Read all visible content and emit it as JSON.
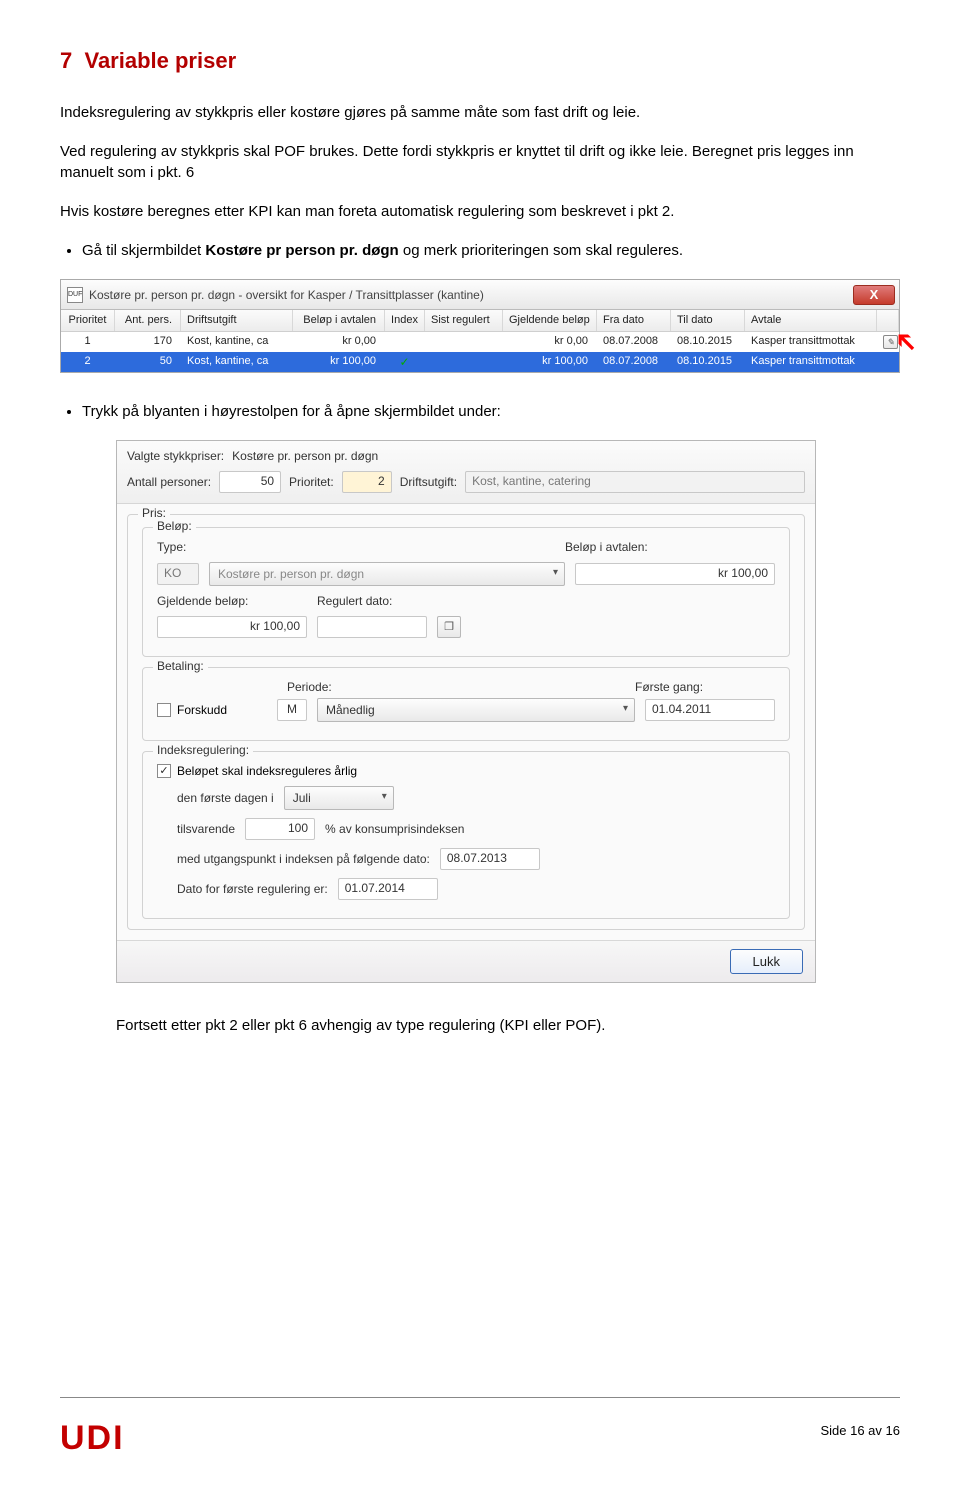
{
  "section": {
    "number": "7",
    "title": "Variable priser",
    "text1": "Indeksregulering av stykkpris eller kostøre gjøres på samme måte som fast drift og leie.",
    "text2": "Ved regulering av stykkpris skal POF brukes. Dette fordi stykkpris er knyttet til drift og ikke leie. Beregnet pris legges inn manuelt som i pkt. 6",
    "text3": "Hvis kostøre beregnes etter KPI kan man foreta automatisk regulering som beskrevet i pkt 2.",
    "bullet1_a": "Gå til skjermbildet ",
    "bullet1_b": "Kostøre pr person pr. døgn",
    "bullet1_c": " og merk prioriteringen som skal reguleres.",
    "bullet2": "Trykk på blyanten i høyrestolpen for å åpne skjermbildet under:",
    "text4": "Fortsett etter pkt 2 eller pkt 6 avhengig av type regulering (KPI eller POF)."
  },
  "grid": {
    "title": "Kostøre pr. person pr. døgn - oversikt for Kasper / Transittplasser (kantine)",
    "app_icon": "DUF",
    "columns": {
      "prioritet": "Prioritet",
      "ant": "Ant. pers.",
      "drift": "Driftsutgift",
      "belop": "Beløp i avtalen",
      "index": "Index",
      "sist": "Sist regulert",
      "gj": "Gjeldende beløp",
      "fra": "Fra dato",
      "til": "Til dato",
      "avtale": "Avtale"
    },
    "rows": [
      {
        "prio": "1",
        "ant": "170",
        "drift": "Kost, kantine, ca",
        "belop": "kr 0,00",
        "index": "",
        "sist": "",
        "gj": "kr 0,00",
        "fra": "08.07.2008",
        "til": "08.10.2015",
        "avt": "Kasper transittmottak"
      },
      {
        "prio": "2",
        "ant": "50",
        "drift": "Kost, kantine, ca",
        "belop": "kr 100,00",
        "index": "✓",
        "sist": "",
        "gj": "kr 100,00",
        "fra": "08.07.2008",
        "til": "08.10.2015",
        "avt": "Kasper transittmottak"
      }
    ]
  },
  "form": {
    "valgte_label": "Valgte stykkpriser:",
    "valgte_value": "Kostøre pr. person pr. døgn",
    "antall_label": "Antall personer:",
    "antall_value": "50",
    "prioritet_label": "Prioritet:",
    "prioritet_value": "2",
    "driftsutgift_label": "Driftsutgift:",
    "driftsutgift_value": "Kost, kantine, catering",
    "pris_legend": "Pris:",
    "belop_legend": "Beløp:",
    "type_label": "Type:",
    "type_code": "KO",
    "type_text": "Kostøre pr. person pr. døgn",
    "belop_avtalen_label": "Beløp i avtalen:",
    "belop_avtalen_value": "kr 100,00",
    "gjeldende_label": "Gjeldende beløp:",
    "gjeldende_value": "kr 100,00",
    "regulert_label": "Regulert dato:",
    "regulert_value": "",
    "betaling_legend": "Betaling:",
    "forskudd_label": "Forskudd",
    "periode_label": "Periode:",
    "periode_code": "M",
    "periode_text": "Månedlig",
    "forste_gang_label": "Første gang:",
    "forste_gang_value": "01.04.2011",
    "indeks_legend": "Indeksregulering:",
    "indeks_chk": "Beløpet skal indeksreguleres årlig",
    "dag_text_a": "den første dagen i",
    "dag_value": "Juli",
    "tilsv_a": "tilsvarende",
    "tilsv_value": "100",
    "tilsv_b": "% av konsumprisindeksen",
    "utgang_a": "med utgangspunkt i indeksen på følgende dato:",
    "utgang_value": "08.07.2013",
    "forste_reg_a": "Dato for første regulering er:",
    "forste_reg_value": "01.07.2014",
    "lukk": "Lukk"
  },
  "footer": {
    "page": "Side 16 av 16",
    "logo": "UDI"
  }
}
